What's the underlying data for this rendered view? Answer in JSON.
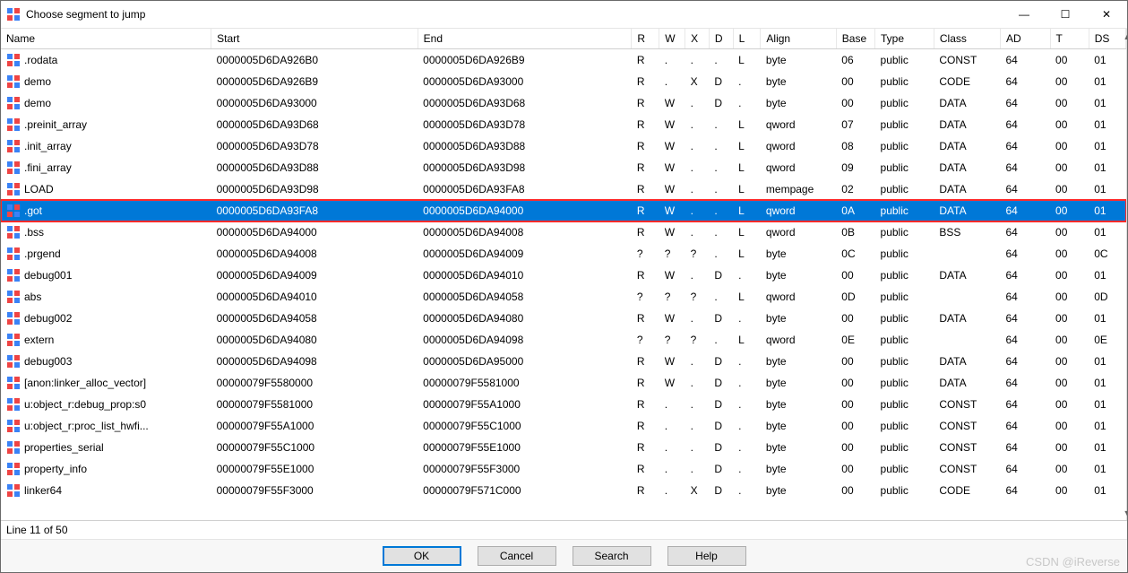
{
  "window": {
    "title": "Choose segment to jump",
    "minimize_glyph": "—",
    "maximize_glyph": "☐",
    "close_glyph": "✕"
  },
  "columns": {
    "name": "Name",
    "start": "Start",
    "end": "End",
    "r": "R",
    "w": "W",
    "x": "X",
    "d": "D",
    "l": "L",
    "align": "Align",
    "base": "Base",
    "type": "Type",
    "class": "Class",
    "ad": "AD",
    "t": "T",
    "ds": "DS"
  },
  "rows": [
    {
      "name": ".rodata",
      "start": "0000005D6DA926B0",
      "end": "0000005D6DA926B9",
      "r": "R",
      "w": ".",
      "x": ".",
      "d": ".",
      "l": "L",
      "align": "byte",
      "base": "06",
      "type": "public",
      "class": "CONST",
      "ad": "64",
      "t": "00",
      "ds": "01",
      "sel": false,
      "box": false
    },
    {
      "name": "demo",
      "start": "0000005D6DA926B9",
      "end": "0000005D6DA93000",
      "r": "R",
      "w": ".",
      "x": "X",
      "d": "D",
      "l": ".",
      "align": "byte",
      "base": "00",
      "type": "public",
      "class": "CODE",
      "ad": "64",
      "t": "00",
      "ds": "01",
      "sel": false,
      "box": false
    },
    {
      "name": "demo",
      "start": "0000005D6DA93000",
      "end": "0000005D6DA93D68",
      "r": "R",
      "w": "W",
      "x": ".",
      "d": "D",
      "l": ".",
      "align": "byte",
      "base": "00",
      "type": "public",
      "class": "DATA",
      "ad": "64",
      "t": "00",
      "ds": "01",
      "sel": false,
      "box": false
    },
    {
      "name": ".preinit_array",
      "start": "0000005D6DA93D68",
      "end": "0000005D6DA93D78",
      "r": "R",
      "w": "W",
      "x": ".",
      "d": ".",
      "l": "L",
      "align": "qword",
      "base": "07",
      "type": "public",
      "class": "DATA",
      "ad": "64",
      "t": "00",
      "ds": "01",
      "sel": false,
      "box": false
    },
    {
      "name": ".init_array",
      "start": "0000005D6DA93D78",
      "end": "0000005D6DA93D88",
      "r": "R",
      "w": "W",
      "x": ".",
      "d": ".",
      "l": "L",
      "align": "qword",
      "base": "08",
      "type": "public",
      "class": "DATA",
      "ad": "64",
      "t": "00",
      "ds": "01",
      "sel": false,
      "box": false
    },
    {
      "name": ".fini_array",
      "start": "0000005D6DA93D88",
      "end": "0000005D6DA93D98",
      "r": "R",
      "w": "W",
      "x": ".",
      "d": ".",
      "l": "L",
      "align": "qword",
      "base": "09",
      "type": "public",
      "class": "DATA",
      "ad": "64",
      "t": "00",
      "ds": "01",
      "sel": false,
      "box": false
    },
    {
      "name": "LOAD",
      "start": "0000005D6DA93D98",
      "end": "0000005D6DA93FA8",
      "r": "R",
      "w": "W",
      "x": ".",
      "d": ".",
      "l": "L",
      "align": "mempage",
      "base": "02",
      "type": "public",
      "class": "DATA",
      "ad": "64",
      "t": "00",
      "ds": "01",
      "sel": false,
      "box": false
    },
    {
      "name": ".got",
      "start": "0000005D6DA93FA8",
      "end": "0000005D6DA94000",
      "r": "R",
      "w": "W",
      "x": ".",
      "d": ".",
      "l": "L",
      "align": "qword",
      "base": "0A",
      "type": "public",
      "class": "DATA",
      "ad": "64",
      "t": "00",
      "ds": "01",
      "sel": true,
      "box": true
    },
    {
      "name": ".bss",
      "start": "0000005D6DA94000",
      "end": "0000005D6DA94008",
      "r": "R",
      "w": "W",
      "x": ".",
      "d": ".",
      "l": "L",
      "align": "qword",
      "base": "0B",
      "type": "public",
      "class": "BSS",
      "ad": "64",
      "t": "00",
      "ds": "01",
      "sel": false,
      "box": false
    },
    {
      "name": ".prgend",
      "start": "0000005D6DA94008",
      "end": "0000005D6DA94009",
      "r": "?",
      "w": "?",
      "x": "?",
      "d": ".",
      "l": "L",
      "align": "byte",
      "base": "0C",
      "type": "public",
      "class": "",
      "ad": "64",
      "t": "00",
      "ds": "0C",
      "sel": false,
      "box": false
    },
    {
      "name": "debug001",
      "start": "0000005D6DA94009",
      "end": "0000005D6DA94010",
      "r": "R",
      "w": "W",
      "x": ".",
      "d": "D",
      "l": ".",
      "align": "byte",
      "base": "00",
      "type": "public",
      "class": "DATA",
      "ad": "64",
      "t": "00",
      "ds": "01",
      "sel": false,
      "box": false
    },
    {
      "name": "abs",
      "start": "0000005D6DA94010",
      "end": "0000005D6DA94058",
      "r": "?",
      "w": "?",
      "x": "?",
      "d": ".",
      "l": "L",
      "align": "qword",
      "base": "0D",
      "type": "public",
      "class": "",
      "ad": "64",
      "t": "00",
      "ds": "0D",
      "sel": false,
      "box": false
    },
    {
      "name": "debug002",
      "start": "0000005D6DA94058",
      "end": "0000005D6DA94080",
      "r": "R",
      "w": "W",
      "x": ".",
      "d": "D",
      "l": ".",
      "align": "byte",
      "base": "00",
      "type": "public",
      "class": "DATA",
      "ad": "64",
      "t": "00",
      "ds": "01",
      "sel": false,
      "box": false
    },
    {
      "name": "extern",
      "start": "0000005D6DA94080",
      "end": "0000005D6DA94098",
      "r": "?",
      "w": "?",
      "x": "?",
      "d": ".",
      "l": "L",
      "align": "qword",
      "base": "0E",
      "type": "public",
      "class": "",
      "ad": "64",
      "t": "00",
      "ds": "0E",
      "sel": false,
      "box": false
    },
    {
      "name": "debug003",
      "start": "0000005D6DA94098",
      "end": "0000005D6DA95000",
      "r": "R",
      "w": "W",
      "x": ".",
      "d": "D",
      "l": ".",
      "align": "byte",
      "base": "00",
      "type": "public",
      "class": "DATA",
      "ad": "64",
      "t": "00",
      "ds": "01",
      "sel": false,
      "box": false
    },
    {
      "name": "[anon:linker_alloc_vector]",
      "start": "00000079F5580000",
      "end": "00000079F5581000",
      "r": "R",
      "w": "W",
      "x": ".",
      "d": "D",
      "l": ".",
      "align": "byte",
      "base": "00",
      "type": "public",
      "class": "DATA",
      "ad": "64",
      "t": "00",
      "ds": "01",
      "sel": false,
      "box": false
    },
    {
      "name": "u:object_r:debug_prop:s0",
      "start": "00000079F5581000",
      "end": "00000079F55A1000",
      "r": "R",
      "w": ".",
      "x": ".",
      "d": "D",
      "l": ".",
      "align": "byte",
      "base": "00",
      "type": "public",
      "class": "CONST",
      "ad": "64",
      "t": "00",
      "ds": "01",
      "sel": false,
      "box": false
    },
    {
      "name": "u:object_r:proc_list_hwfi...",
      "start": "00000079F55A1000",
      "end": "00000079F55C1000",
      "r": "R",
      "w": ".",
      "x": ".",
      "d": "D",
      "l": ".",
      "align": "byte",
      "base": "00",
      "type": "public",
      "class": "CONST",
      "ad": "64",
      "t": "00",
      "ds": "01",
      "sel": false,
      "box": false
    },
    {
      "name": "properties_serial",
      "start": "00000079F55C1000",
      "end": "00000079F55E1000",
      "r": "R",
      "w": ".",
      "x": ".",
      "d": "D",
      "l": ".",
      "align": "byte",
      "base": "00",
      "type": "public",
      "class": "CONST",
      "ad": "64",
      "t": "00",
      "ds": "01",
      "sel": false,
      "box": false
    },
    {
      "name": "property_info",
      "start": "00000079F55E1000",
      "end": "00000079F55F3000",
      "r": "R",
      "w": ".",
      "x": ".",
      "d": "D",
      "l": ".",
      "align": "byte",
      "base": "00",
      "type": "public",
      "class": "CONST",
      "ad": "64",
      "t": "00",
      "ds": "01",
      "sel": false,
      "box": false
    },
    {
      "name": "linker64",
      "start": "00000079F55F3000",
      "end": "00000079F571C000",
      "r": "R",
      "w": ".",
      "x": "X",
      "d": "D",
      "l": ".",
      "align": "byte",
      "base": "00",
      "type": "public",
      "class": "CODE",
      "ad": "64",
      "t": "00",
      "ds": "01",
      "sel": false,
      "box": false
    }
  ],
  "status": "Line 11 of 50",
  "buttons": {
    "ok": "OK",
    "cancel": "Cancel",
    "search": "Search",
    "help": "Help"
  },
  "watermark": "CSDN @iReverse",
  "icon_colors": {
    "tl": "#3b82f6",
    "tr": "#ef4444",
    "bl": "#ef4444",
    "br": "#3b82f6"
  }
}
